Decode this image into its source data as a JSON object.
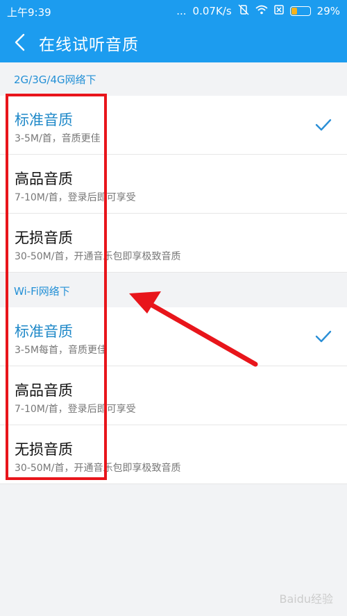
{
  "status_bar": {
    "time": "上午9:39",
    "dots": "...",
    "net_speed": "0.07K/s",
    "battery_pct": "29%",
    "battery_level": 0.29,
    "icons": [
      "wifi-icon",
      "vibrate-icon",
      "sim-off-icon",
      "battery-icon"
    ]
  },
  "header": {
    "title": "在线试听音质",
    "back_icon": "chevron-left-icon",
    "background": "#1c9cef"
  },
  "sections": [
    {
      "title": "2G/3G/4G网络下",
      "items": [
        {
          "label": "标准音质",
          "desc": "3-5M/首，音质更佳",
          "selected": true
        },
        {
          "label": "高品音质",
          "desc": "7-10M/首，登录后即可享受",
          "selected": false
        },
        {
          "label": "无损音质",
          "desc": "30-50M/首，开通音乐包即享极致音质",
          "selected": false
        }
      ]
    },
    {
      "title": "Wi-Fi网络下",
      "items": [
        {
          "label": "标准音质",
          "desc": "3-5M每首，音质更佳",
          "selected": true
        },
        {
          "label": "高品音质",
          "desc": "7-10M/首，登录后即可享受",
          "selected": false
        },
        {
          "label": "无损音质",
          "desc": "30-50M/首，开通音乐包即享极致音质",
          "selected": false
        }
      ]
    }
  ],
  "colors": {
    "accent": "#1c9cef",
    "selected_text": "#1e88c8",
    "annotation": "#e8151b"
  },
  "watermark": "Baidu经验"
}
